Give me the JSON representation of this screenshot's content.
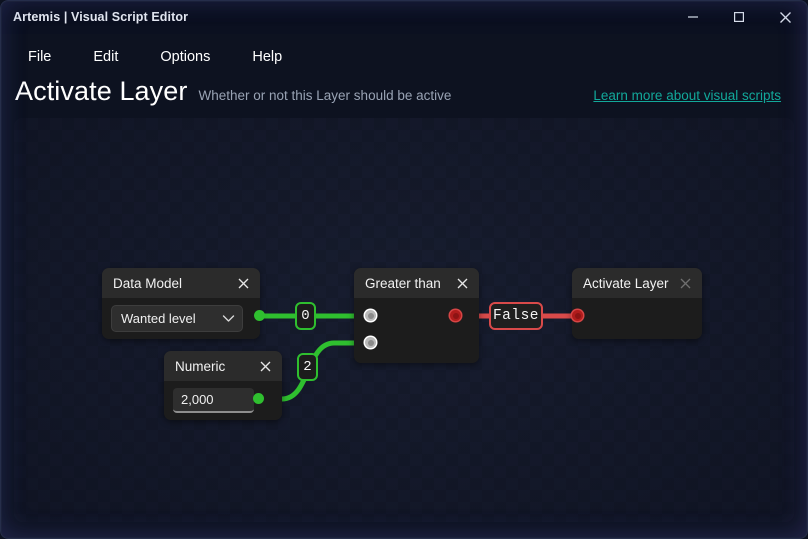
{
  "window": {
    "title": "Artemis | Visual Script Editor",
    "controls": [
      {
        "name": "minimize",
        "label": "Minimize"
      },
      {
        "name": "maximize",
        "label": "Maximize"
      },
      {
        "name": "close",
        "label": "Close"
      }
    ]
  },
  "menubar": {
    "items": [
      {
        "label": "File"
      },
      {
        "label": "Edit"
      },
      {
        "label": "Options"
      },
      {
        "label": "Help"
      }
    ]
  },
  "header": {
    "title": "Activate Layer",
    "subtitle": "Whether or not this Layer should be active",
    "link": "Learn more about visual scripts",
    "link_color": "#12a89a"
  },
  "graph": {
    "nodes": [
      {
        "id": "data-model",
        "title": "Data Model",
        "close_label": "×",
        "control": {
          "type": "select",
          "value": "Wanted level"
        },
        "output_pin": {
          "type": "green"
        }
      },
      {
        "id": "numeric",
        "title": "Numeric",
        "close_label": "×",
        "control": {
          "type": "input",
          "value": "2,000"
        },
        "output_pin": {
          "type": "green"
        }
      },
      {
        "id": "greater-than",
        "title": "Greater than",
        "close_label": "×",
        "input_pins": [
          {
            "type": "hollow"
          },
          {
            "type": "hollow"
          }
        ],
        "output_pin": {
          "type": "red"
        }
      },
      {
        "id": "activate-layer",
        "title": "Activate Layer",
        "close_label": "×",
        "input_pins": [
          {
            "type": "red"
          }
        ]
      }
    ],
    "wires": [
      {
        "id": "wire-0",
        "badge": "0",
        "color": "#2fbf2f",
        "kind": "green"
      },
      {
        "id": "wire-2",
        "badge": "2",
        "color": "#2fbf2f",
        "kind": "green"
      },
      {
        "id": "wire-false",
        "badge": "False",
        "color": "#d94a4a",
        "kind": "red"
      }
    ],
    "colors": {
      "green": "#2fbf2f",
      "red": "#d94a4a",
      "node_bg": "#1c1c1c",
      "node_header": "#2b2b2b"
    }
  }
}
